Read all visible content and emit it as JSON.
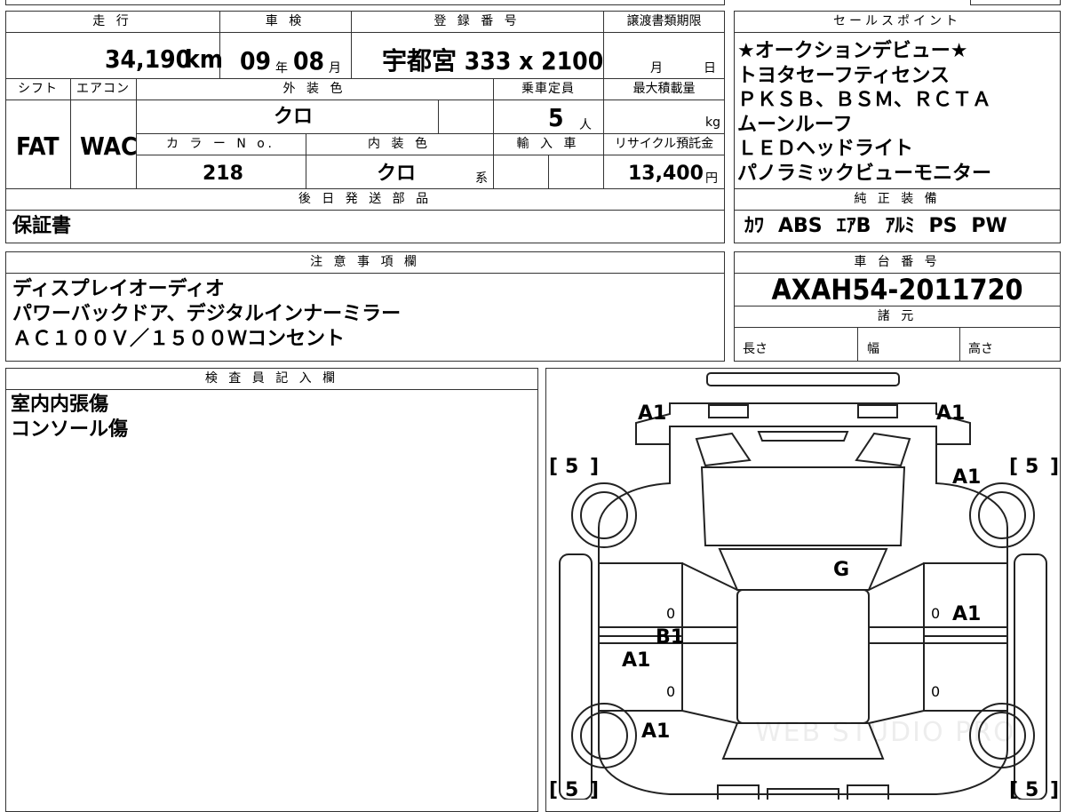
{
  "vehicle": {
    "mileage_label": "走 行",
    "mileage_value": "34,190",
    "mileage_unit": "km",
    "inspection_label": "車 検",
    "inspection_year": "09",
    "inspection_year_unit": "年",
    "inspection_month": "08",
    "inspection_month_unit": "月",
    "registration_label": "登 録 番 号",
    "registration_value": "宇都宮 333 x 2100",
    "transfer_doc_label": "譲渡書類期限",
    "transfer_month_unit": "月",
    "transfer_day_unit": "日",
    "shift_label": "シフト",
    "shift_value": "FAT",
    "aircon_label": "エアコン",
    "aircon_value": "WAC",
    "exterior_color_label": "外 装 色",
    "exterior_color_value": "クロ",
    "capacity_label": "乗車定員",
    "capacity_value": "5",
    "capacity_unit": "人",
    "max_load_label": "最大積載量",
    "max_load_unit": "kg",
    "color_no_label": "カ ラ ー N o.",
    "color_no_value": "218",
    "interior_color_label": "内 装 色",
    "interior_color_value": "クロ",
    "interior_color_unit": "系",
    "import_label": "輸 入 車",
    "recycle_label": "リサイクル預託金",
    "recycle_value": "13,400",
    "recycle_unit": "円",
    "later_parts_label": "後 日 発 送 部 品",
    "later_parts_value": "保証書"
  },
  "sales_points": {
    "label": "セールスポイント",
    "lines": [
      "★オークションデビュー★",
      "トヨタセーフティセンス",
      "ＰＫＳＢ、ＢＳＭ、ＲＣＴＡ",
      "ムーンルーフ",
      "ＬＥＤヘッドライト",
      "パノラミックビューモニター"
    ]
  },
  "equipment": {
    "label": "純 正 装 備",
    "items": [
      "ｶﾜ",
      "ABS",
      "ｴｱB",
      "ｱﾙﾐ",
      "PS",
      "PW"
    ]
  },
  "notes": {
    "label": "注 意 事 項 欄",
    "lines": [
      "ディスプレイオーディオ",
      "パワーバックドア、デジタルインナーミラー",
      "ＡＣ１００Ｖ／１５００Ｗコンセント"
    ]
  },
  "chassis": {
    "label": "車 台 番 号",
    "value": "AXAH54-2011720",
    "specs_label": "諸 元",
    "length_label": "長さ",
    "width_label": "幅",
    "height_label": "高さ"
  },
  "inspector": {
    "label": "検 査 員 記 入 欄",
    "lines": [
      "室内内張傷",
      "コンソール傷"
    ]
  },
  "diagram": {
    "marks": {
      "front_left": "A1",
      "front_right": "A1",
      "right_fender": "A1",
      "hood": "G",
      "right_front_door": "A1",
      "left_front_door_b": "B1",
      "left_front_door_a": "A1",
      "left_rear": "A1"
    },
    "tire_values": {
      "front_left": "5",
      "front_right": "5",
      "rear_left": "5",
      "rear_right": "5"
    },
    "door_marks": [
      "0",
      "0",
      "0",
      "0"
    ],
    "watermark": "WEB STUDIO PRO"
  }
}
